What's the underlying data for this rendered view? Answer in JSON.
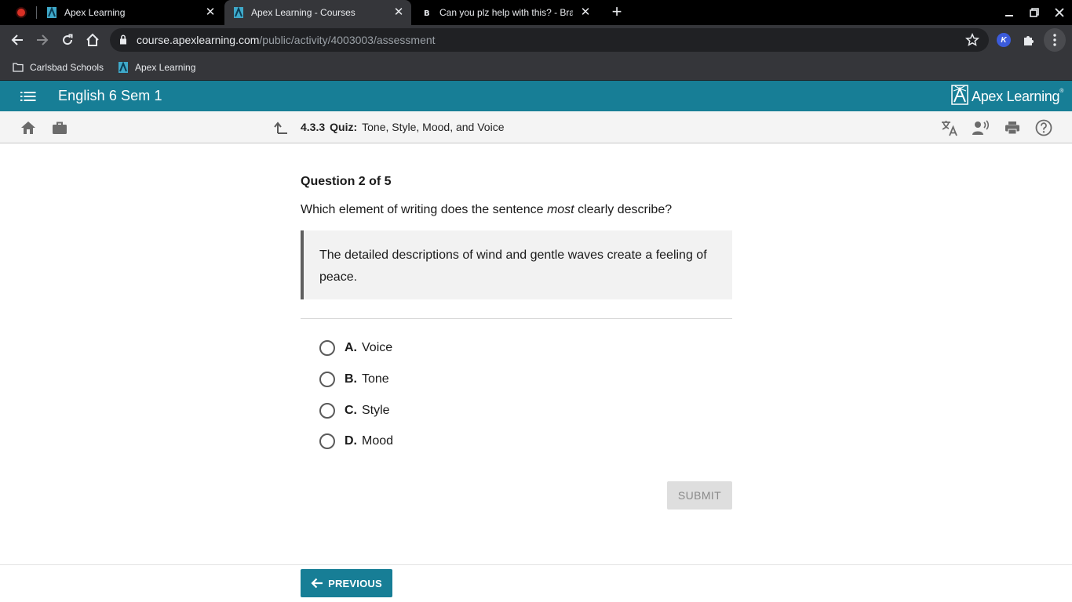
{
  "browser": {
    "tabs": [
      {
        "title": "Apex Learning",
        "active": false,
        "favicon": "apex-favicon"
      },
      {
        "title": "Apex Learning - Courses",
        "active": true,
        "favicon": "apex-favicon"
      },
      {
        "title": "Can you plz help with this? - Brai",
        "active": false,
        "favicon": "brainly-favicon"
      }
    ],
    "url_host": "course.apexlearning.com",
    "url_path": "/public/activity/4003003/assessment",
    "extension_badge": "K",
    "bookmarks": [
      {
        "label": "Carlsbad Schools",
        "icon": "folder-icon"
      },
      {
        "label": "Apex Learning",
        "icon": "apex-favicon"
      }
    ]
  },
  "app": {
    "course_title": "English 6 Sem 1",
    "logo_text": "Apex Learning",
    "logo_mark": "®",
    "activity_number": "4.3.3",
    "activity_type": "Quiz:",
    "activity_title": "Tone, Style, Mood, and Voice"
  },
  "question": {
    "counter": "Question 2 of 5",
    "prompt_before": "Which element of writing does the sentence ",
    "prompt_emphasis": "most",
    "prompt_after": " clearly describe?",
    "passage": "The detailed descriptions of wind and gentle waves create a feeling of peace.",
    "choices": [
      {
        "letter": "A.",
        "text": "Voice"
      },
      {
        "letter": "B.",
        "text": "Tone"
      },
      {
        "letter": "C.",
        "text": "Style"
      },
      {
        "letter": "D.",
        "text": "Mood"
      }
    ],
    "submit_label": "SUBMIT"
  },
  "footer": {
    "previous_label": "PREVIOUS"
  },
  "colors": {
    "brand_teal": "#177e96",
    "submit_disabled_bg": "#dedede"
  }
}
